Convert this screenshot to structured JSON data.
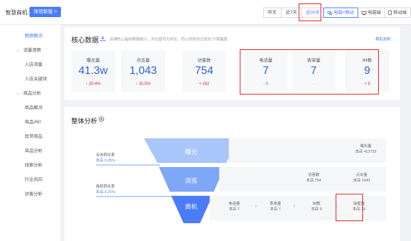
{
  "header": {
    "logo": "智慧商机",
    "switch_label": "体验新版 >",
    "ranges": [
      "昨天",
      "近7天",
      "近30天"
    ],
    "active_range": "近30天",
    "devices": [
      "电脑+移动",
      "电脑端",
      "移动端"
    ],
    "active_device": "电脑+移动"
  },
  "sidebar": {
    "items": [
      {
        "label": "数据概况",
        "active": true
      },
      {
        "label": "流量洞察",
        "group": true
      },
      {
        "label": "入店流量"
      },
      {
        "label": "入店关键词"
      },
      {
        "label": "商品分析",
        "group": true
      },
      {
        "label": "商品概况"
      },
      {
        "label": "商品360"
      },
      {
        "label": "异常商品"
      },
      {
        "label": "单品分析"
      },
      {
        "label": "线索分析"
      },
      {
        "label": "行业风向"
      },
      {
        "label": "访客分析"
      }
    ]
  },
  "core": {
    "title": "核心数据",
    "subtitle": "店铺核心指标数据统计，对比值均为环比，同上时段对比增长/下降幅度",
    "help": "帮助说明",
    "metrics": [
      {
        "label": "曝光量",
        "value": "41.3w",
        "change": "↑ 20.4%",
        "trend": "up"
      },
      {
        "label": "点击量",
        "value": "1,043",
        "change": "↑ 31.5%",
        "trend": "up"
      },
      {
        "label": "访客数",
        "value": "754",
        "change": "+ 192",
        "trend": "up"
      },
      {
        "label": "电话量",
        "value": "7",
        "change": "- 9",
        "trend": "down"
      },
      {
        "label": "表单量",
        "value": "7",
        "change": "-",
        "trend": "flat"
      },
      {
        "label": "IM数",
        "value": "9",
        "change": "+ 5",
        "trend": "up"
      }
    ]
  },
  "funnel": {
    "title": "整体分析",
    "stages": [
      "曝光",
      "浏览",
      "商机"
    ],
    "rates": [
      {
        "label": "点击转化率",
        "value": "本店 0.25%"
      },
      {
        "label": "商机转化率",
        "value": "本店 2.21%"
      }
    ],
    "exposure": {
      "label": "曝光量",
      "value": "本店 412733"
    },
    "browse": [
      {
        "label": "访客数",
        "value": "本店 754"
      },
      {
        "label": "点击量",
        "value": "本店 1043"
      }
    ],
    "leads": [
      {
        "label": "电话量",
        "value": "本店 7"
      },
      {
        "label": "表单量",
        "value": "本店 7"
      },
      {
        "label": "IM数",
        "value": "本店 9"
      },
      {
        "label": "询盘量",
        "value": "本店 23"
      }
    ]
  },
  "colors": {
    "accent": "#4a7cf7",
    "value": "#2a5fdc",
    "up": "#e0201c",
    "down": "#2ab06a",
    "highlight": "#e0201c"
  }
}
